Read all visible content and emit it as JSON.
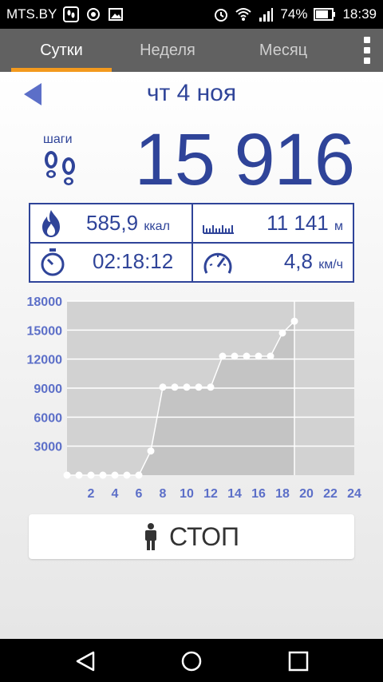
{
  "status_bar": {
    "carrier": "MTS.BY",
    "battery": "74%",
    "time": "18:39",
    "icons": [
      "footprint-notification-icon",
      "record-icon",
      "image-icon",
      "alarm-icon",
      "wifi-icon",
      "signal-icon",
      "battery-icon"
    ]
  },
  "tabs": [
    {
      "label": "Сутки",
      "active": true
    },
    {
      "label": "Неделя",
      "active": false
    },
    {
      "label": "Месяц",
      "active": false
    }
  ],
  "header": {
    "date": "чт 4 ноя"
  },
  "steps": {
    "label": "шаги",
    "count": "15 916"
  },
  "stats": {
    "calories": {
      "value": "585,9",
      "unit": "ккал"
    },
    "distance": {
      "value": "11 141",
      "unit": "м"
    },
    "duration": {
      "value": "02:18:12"
    },
    "speed": {
      "value": "4,8",
      "unit": "км/ч"
    }
  },
  "chart_data": {
    "type": "area",
    "x_ticks": [
      "2",
      "4",
      "6",
      "8",
      "10",
      "12",
      "14",
      "16",
      "18",
      "20",
      "22",
      "24"
    ],
    "y_ticks": [
      "3000",
      "6000",
      "9000",
      "12000",
      "15000",
      "18000"
    ],
    "ylim": [
      0,
      18000
    ],
    "xlim": [
      0,
      24
    ],
    "grid": true,
    "x": [
      0,
      1,
      2,
      3,
      4,
      5,
      6,
      7,
      8,
      9,
      10,
      11,
      12,
      13,
      14,
      15,
      16,
      17,
      18,
      19
    ],
    "values": [
      0,
      0,
      0,
      0,
      0,
      0,
      0,
      2500,
      9100,
      9100,
      9100,
      9100,
      9100,
      12300,
      12300,
      12300,
      12300,
      12300,
      14700,
      15916
    ],
    "colors": {
      "fill_past": "#c4c4c4",
      "fill_future": "#d2d2d2",
      "line": "#ffffff",
      "tick": "#5c6fc8"
    }
  },
  "stop_button": {
    "label": "СТОП"
  },
  "colors": {
    "accent": "#2f4499",
    "tab_indicator": "#f39a1e",
    "tabbar": "#616161"
  }
}
